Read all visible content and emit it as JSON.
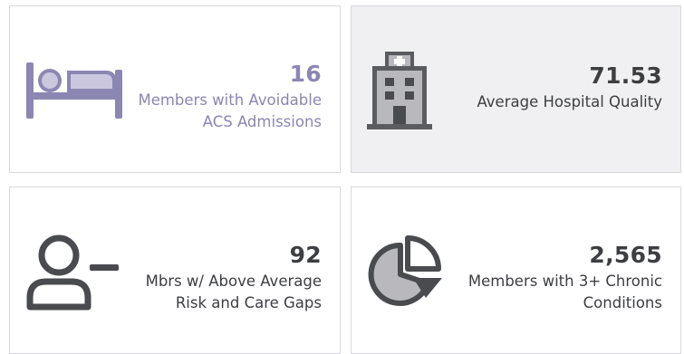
{
  "tiles": [
    {
      "value": "16",
      "label_line1": "Members with Avoidable",
      "label_line2": "ACS Admissions",
      "icon": "hospital-bed-icon",
      "color": "#8c86b3"
    },
    {
      "value": "71.53",
      "label_line1": "Average Hospital Quality",
      "label_line2": "",
      "icon": "hospital-building-icon",
      "color": "#3d3e42"
    },
    {
      "value": "92",
      "label_line1": "Mbrs w/ Above Average",
      "label_line2": "Risk and Care Gaps",
      "icon": "person-minus-icon",
      "color": "#3d3e42"
    },
    {
      "value": "2,565",
      "label_line1": "Members with 3+ Chronic",
      "label_line2": "Conditions",
      "icon": "pie-chart-icon",
      "color": "#3d3e42"
    }
  ]
}
